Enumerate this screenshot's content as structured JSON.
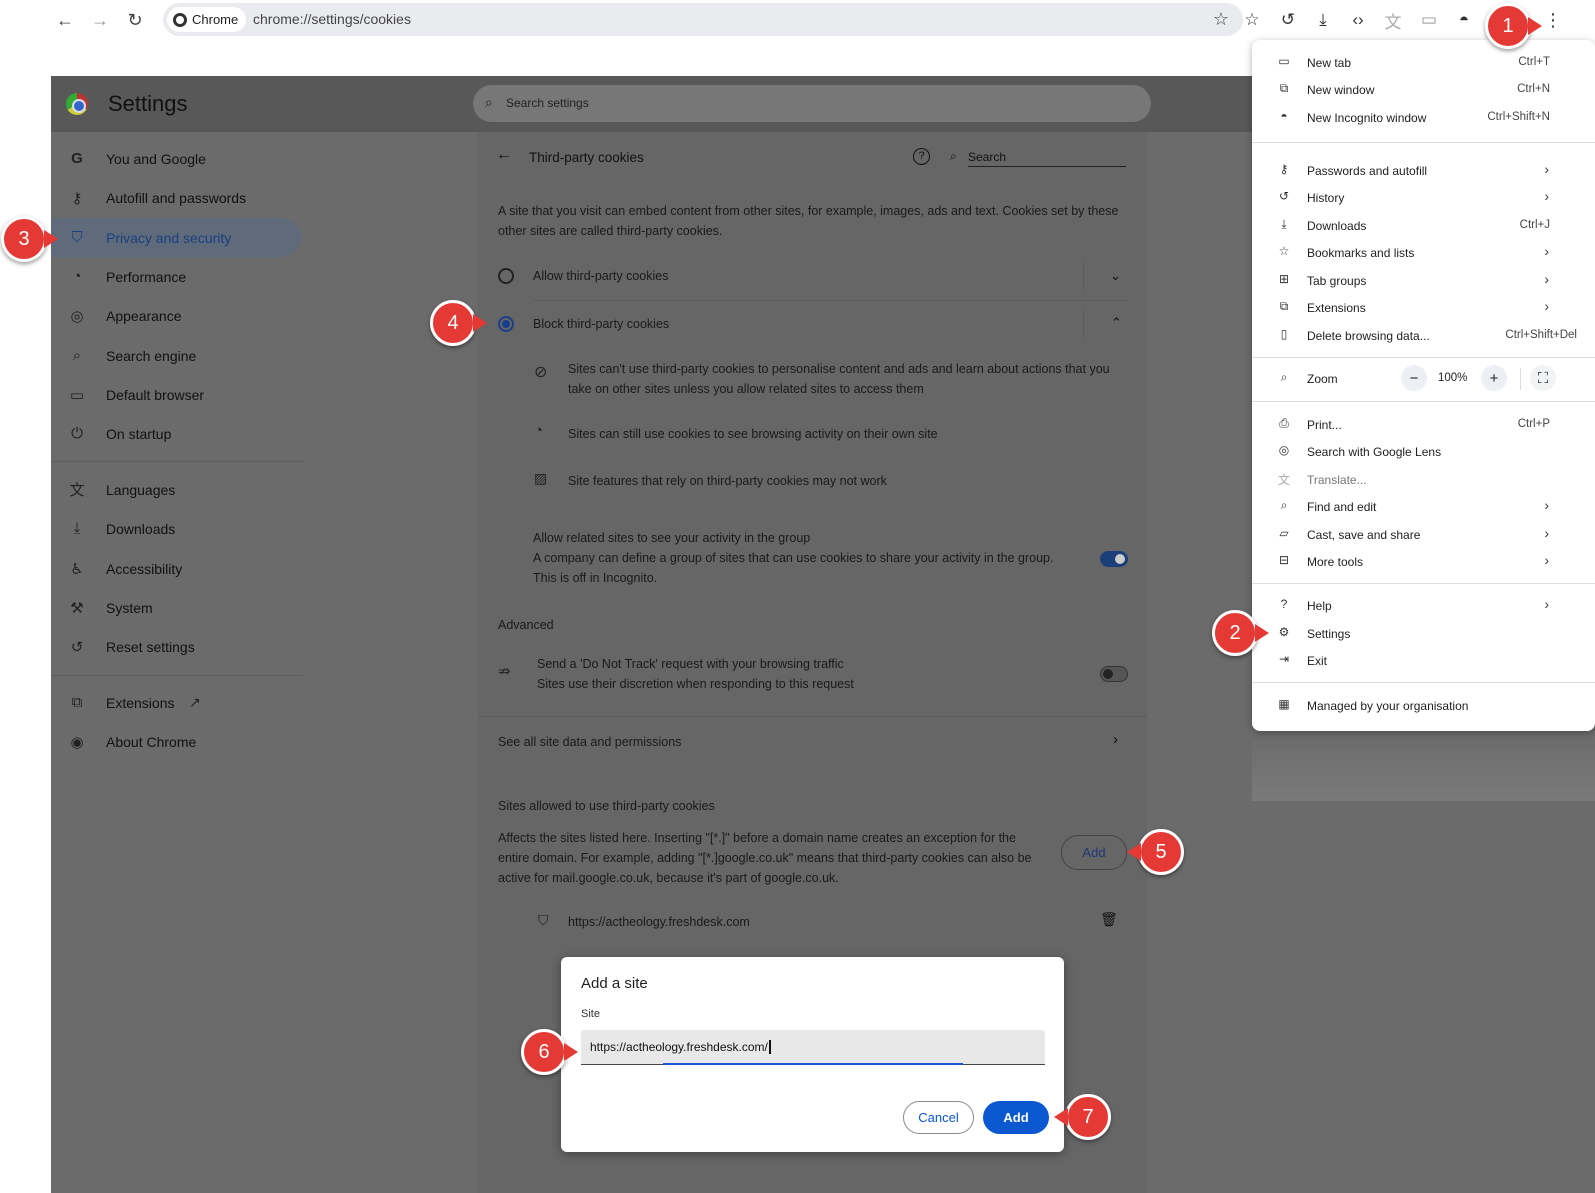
{
  "browser": {
    "chip_label": "Chrome",
    "url": "chrome://settings/cookies"
  },
  "settings": {
    "title": "Settings",
    "search_placeholder": "Search settings",
    "sidebar": [
      {
        "label": "You and Google",
        "icon": "google-g-icon"
      },
      {
        "label": "Autofill and passwords",
        "icon": "key-icon"
      },
      {
        "label": "Privacy and security",
        "icon": "shield-icon",
        "active": true
      },
      {
        "label": "Performance",
        "icon": "speedometer-icon"
      },
      {
        "label": "Appearance",
        "icon": "palette-icon"
      },
      {
        "label": "Search engine",
        "icon": "search-icon"
      },
      {
        "label": "Default browser",
        "icon": "browser-window-icon"
      },
      {
        "label": "On startup",
        "icon": "power-icon"
      },
      {
        "label": "Languages",
        "icon": "translate-icon"
      },
      {
        "label": "Downloads",
        "icon": "download-icon"
      },
      {
        "label": "Accessibility",
        "icon": "accessibility-icon"
      },
      {
        "label": "System",
        "icon": "wrench-icon"
      },
      {
        "label": "Reset settings",
        "icon": "reset-icon"
      },
      {
        "label": "Extensions",
        "icon": "puzzle-icon"
      },
      {
        "label": "About Chrome",
        "icon": "chrome-icon"
      }
    ]
  },
  "cookies": {
    "title": "Third-party cookies",
    "search_placeholder": "Search",
    "intro": "A site that you visit can embed content from other sites, for example, images, ads and text. Cookies set by these other sites are called third-party cookies.",
    "option_allow": "Allow third-party cookies",
    "option_block": "Block third-party cookies",
    "block_details": [
      "Sites can't use third-party cookies to personalise content and ads and learn about actions that you take on other sites unless you allow related sites to access them",
      "Sites can still use cookies to see browsing activity on their own site",
      "Site features that rely on third-party cookies may not work"
    ],
    "related_title": "Allow related sites to see your activity in the group",
    "related_desc": "A company can define a group of sites that can use cookies to share your activity in the group. This is off in Incognito.",
    "related_enabled": true,
    "advanced_heading": "Advanced",
    "dnt_title": "Send a 'Do Not Track' request with your browsing traffic",
    "dnt_desc": "Sites use their discretion when responding to this request",
    "dnt_enabled": false,
    "see_all": "See all site data and permissions",
    "allowed_heading": "Sites allowed to use third-party cookies",
    "allowed_desc": "Affects the sites listed here. Inserting \"[*.]\" before a domain name creates an exception for the entire domain. For example, adding \"[*.]google.co.uk\" means that third-party cookies can also be active for mail.google.co.uk, because it's part of google.co.uk.",
    "add_button": "Add",
    "allowed_sites": [
      "https://actheology.freshdesk.com"
    ]
  },
  "dialog": {
    "title": "Add a site",
    "field_label": "Site",
    "field_value": "https://actheology.freshdesk.com/",
    "cancel": "Cancel",
    "add": "Add"
  },
  "menu": {
    "items": [
      {
        "label": "New tab",
        "shortcut": "Ctrl+T",
        "icon": "new-tab-icon"
      },
      {
        "label": "New window",
        "shortcut": "Ctrl+N",
        "icon": "new-window-icon"
      },
      {
        "label": "New Incognito window",
        "shortcut": "Ctrl+Shift+N",
        "icon": "incognito-icon"
      },
      {
        "label": "Passwords and autofill",
        "arrow": true,
        "icon": "key-icon"
      },
      {
        "label": "History",
        "arrow": true,
        "icon": "history-icon"
      },
      {
        "label": "Downloads",
        "shortcut": "Ctrl+J",
        "icon": "download-icon"
      },
      {
        "label": "Bookmarks and lists",
        "arrow": true,
        "icon": "star-icon"
      },
      {
        "label": "Tab groups",
        "arrow": true,
        "icon": "tab-groups-icon"
      },
      {
        "label": "Extensions",
        "arrow": true,
        "icon": "puzzle-icon"
      },
      {
        "label": "Delete browsing data...",
        "shortcut": "Ctrl+Shift+Del",
        "icon": "trash-icon"
      },
      {
        "label": "Print...",
        "shortcut": "Ctrl+P",
        "icon": "printer-icon"
      },
      {
        "label": "Search with Google Lens",
        "icon": "lens-icon"
      },
      {
        "label": "Translate...",
        "icon": "translate-icon",
        "disabled": true
      },
      {
        "label": "Find and edit",
        "arrow": true,
        "icon": "find-icon"
      },
      {
        "label": "Cast, save and share",
        "arrow": true,
        "icon": "cast-icon"
      },
      {
        "label": "More tools",
        "arrow": true,
        "icon": "toolbox-icon"
      },
      {
        "label": "Help",
        "arrow": true,
        "icon": "help-icon"
      },
      {
        "label": "Settings",
        "icon": "gear-icon"
      },
      {
        "label": "Exit",
        "icon": "exit-icon"
      },
      {
        "label": "Managed by your organisation",
        "icon": "building-icon"
      }
    ],
    "zoom_label": "Zoom",
    "zoom_value": "100%"
  },
  "callouts": [
    "1",
    "2",
    "3",
    "4",
    "5",
    "6",
    "7"
  ],
  "colors": {
    "accent": "#0b57d0",
    "callout": "#e53935",
    "overlay": "#6b6b6b"
  }
}
